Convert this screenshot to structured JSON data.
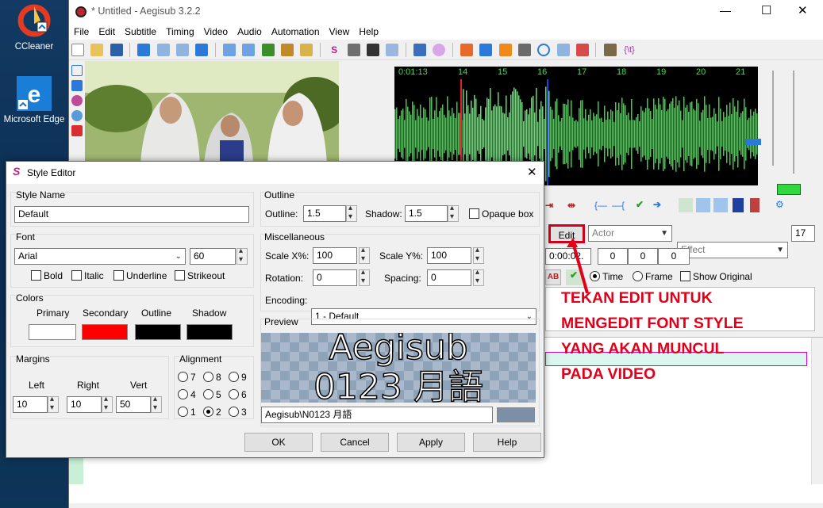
{
  "desktop": {
    "icons": [
      {
        "label": "CCleaner"
      },
      {
        "label": "Microsoft Edge"
      }
    ]
  },
  "window": {
    "title": "* Untitled - Aegisub 3.2.2",
    "menu": [
      "File",
      "Edit",
      "Subtitle",
      "Timing",
      "Video",
      "Audio",
      "Automation",
      "View",
      "Help"
    ],
    "controls": {
      "minimize": "—",
      "maximize": "☐",
      "close": "✕"
    }
  },
  "audio": {
    "timeline": [
      "0:01:13",
      "14",
      "15",
      "16",
      "17",
      "18",
      "19",
      "20",
      "21"
    ]
  },
  "edit_panel": {
    "edit_button": "Edit",
    "actor_placeholder": "Actor",
    "effect_placeholder": "Effect",
    "layer_value": "17",
    "time_value": "0:00:02.",
    "margin_values": [
      "0",
      "0",
      "0"
    ],
    "bold_label": "AB",
    "time_radio": "Time",
    "frame_radio": "Frame",
    "show_original": "Show Original"
  },
  "annotation": {
    "lines": [
      "TEKAN EDIT UNTUK",
      "MENGEDIT FONT STYLE",
      "YANG AKAN MUNCUL",
      "PADA VIDEO"
    ],
    "color": "#e0001a"
  },
  "dialog": {
    "title": "Style Editor",
    "style_name_label": "Style Name",
    "style_name_value": "Default",
    "font_label": "Font",
    "font_value": "Arial",
    "font_size": "60",
    "bold": "Bold",
    "italic": "Italic",
    "underline": "Underline",
    "strikeout": "Strikeout",
    "colors_label": "Colors",
    "colors": [
      {
        "label": "Primary",
        "hex": "#ffffff"
      },
      {
        "label": "Secondary",
        "hex": "#ff0000"
      },
      {
        "label": "Outline",
        "hex": "#000000"
      },
      {
        "label": "Shadow",
        "hex": "#000000"
      }
    ],
    "margins_label": "Margins",
    "margin_left_label": "Left",
    "margin_right_label": "Right",
    "margin_vert_label": "Vert",
    "margin_left": "10",
    "margin_right": "10",
    "margin_vert": "50",
    "alignment_label": "Alignment",
    "alignment_options": [
      "7",
      "8",
      "9",
      "4",
      "5",
      "6",
      "1",
      "2",
      "3"
    ],
    "alignment_selected": "2",
    "outline_group": "Outline",
    "outline_label": "Outline:",
    "outline_value": "1.5",
    "shadow_label": "Shadow:",
    "shadow_value": "1.5",
    "opaque_box": "Opaque box",
    "misc_label": "Miscellaneous",
    "scale_x_label": "Scale X%:",
    "scale_x_value": "100",
    "scale_y_label": "Scale Y%:",
    "scale_y_value": "100",
    "rotation_label": "Rotation:",
    "rotation_value": "0",
    "spacing_label": "Spacing:",
    "spacing_value": "0",
    "encoding_label": "Encoding:",
    "encoding_value": "1 - Default",
    "preview_label": "Preview",
    "preview_line1": "Aegisub",
    "preview_line2": "0123 月語",
    "preview_text_field": "Aegisub\\N0123 月語",
    "preview_bg_color": "#7b90a8",
    "buttons": {
      "ok": "OK",
      "cancel": "Cancel",
      "apply": "Apply",
      "help": "Help"
    }
  },
  "colors": {
    "wave": "#2fd83c",
    "wave_selected": "#4fe860",
    "window_bg": "#f0f0f0"
  }
}
